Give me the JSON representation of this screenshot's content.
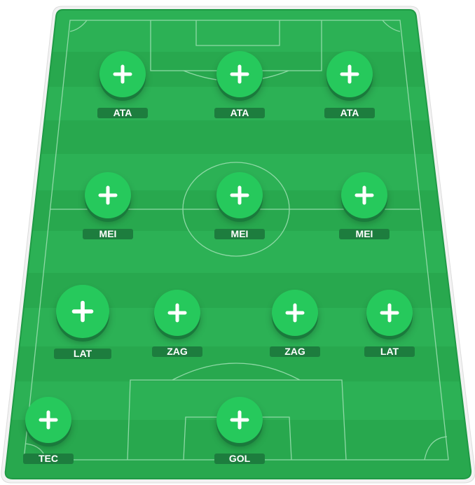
{
  "colors": {
    "pitch_light": "#2db156",
    "pitch_dark": "#28a84e",
    "pitch_lines": "#8fd9a6",
    "button": "#26c95c",
    "button_shadow": "#1a7a3c",
    "label_bg": "#1d7d3e",
    "label_text": "#ffffff"
  },
  "icons": {
    "add": "plus-icon"
  },
  "formation": {
    "attackers": [
      {
        "label": "ATA"
      },
      {
        "label": "ATA"
      },
      {
        "label": "ATA"
      }
    ],
    "midfielders": [
      {
        "label": "MEI"
      },
      {
        "label": "MEI"
      },
      {
        "label": "MEI"
      }
    ],
    "defenders": [
      {
        "label": "LAT"
      },
      {
        "label": "ZAG"
      },
      {
        "label": "ZAG"
      },
      {
        "label": "LAT"
      }
    ],
    "goalkeeper": {
      "label": "GOL"
    },
    "coach": {
      "label": "TEC"
    }
  }
}
